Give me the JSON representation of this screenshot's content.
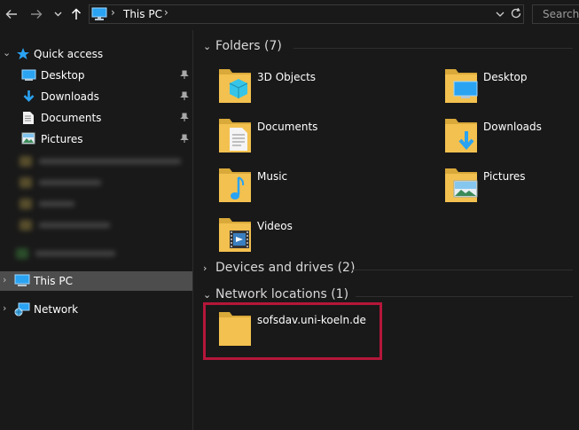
{
  "address_bar": {
    "path": "This PC",
    "search_placeholder": "Search T"
  },
  "sidebar": {
    "quick_access": "Quick access",
    "pinned": [
      {
        "label": "Desktop",
        "icon": "desktop-icon"
      },
      {
        "label": "Downloads",
        "icon": "downloads-icon"
      },
      {
        "label": "Documents",
        "icon": "documents-icon"
      },
      {
        "label": "Pictures",
        "icon": "pictures-icon"
      }
    ],
    "this_pc": "This PC",
    "network": "Network"
  },
  "groups": {
    "folders": {
      "title": "Folders (7)"
    },
    "devices": {
      "title": "Devices and drives (2)"
    },
    "network_locations": {
      "title": "Network locations (1)"
    }
  },
  "folders": [
    {
      "name": "3D Objects",
      "icon": "3d-objects-icon"
    },
    {
      "name": "Desktop",
      "icon": "desktop-folder-icon"
    },
    {
      "name": "Documents",
      "icon": "documents-folder-icon"
    },
    {
      "name": "Downloads",
      "icon": "downloads-folder-icon"
    },
    {
      "name": "Music",
      "icon": "music-folder-icon"
    },
    {
      "name": "Pictures",
      "icon": "pictures-folder-icon"
    },
    {
      "name": "Videos",
      "icon": "videos-folder-icon"
    }
  ],
  "network_locations": [
    {
      "name": "sofsdav.uni-koeln.de",
      "icon": "network-folder-icon"
    }
  ],
  "colors": {
    "highlight": "#b5163a",
    "accent": "#2aa3f2",
    "folder": "#f3c14f",
    "selected_row": "#4d4d4d"
  }
}
